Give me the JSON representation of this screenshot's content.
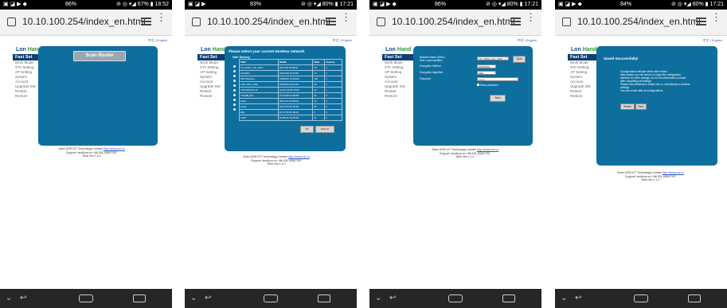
{
  "phones": [
    {
      "status_left": "▣ ◪ ▶ ◆",
      "battery": "86%",
      "status_right": "⊘ ◎ ▾◢ 67% ▮ 18:52",
      "url": "10.10.100.254/index_en.html"
    },
    {
      "status_left": "▣ ◪ ▶",
      "battery": "83%",
      "status_right": "⊘ ◎ ▾◢ 80% ▮ 17:21",
      "url": "10.10.100.254/index_en.html"
    },
    {
      "status_left": "▣ ◪ ▶ ◆",
      "battery": "86%",
      "status_right": "⊘ ◎ ▾◢ 80% ▮ 17:21",
      "url": "10.10.100.254/index_en.html"
    },
    {
      "status_left": "▣ ◪ ▶ ◆",
      "battery": "84%",
      "status_right": "⊘ ◎ ▾◢ 80% ▮ 17:21",
      "url": "10.10.100.254/index_en.html"
    }
  ],
  "lang_links": "中文 | English",
  "brand": {
    "lon": "Lon ",
    "hand": "Hand"
  },
  "nav_items": [
    "Fast Set",
    "Work Mode",
    "STA Setting",
    "AP Setting",
    "System",
    "Account",
    "Upgrade SW",
    "Restart",
    "Restore"
  ],
  "footer": {
    "company": "Jinan USR IOT Technology Limited",
    "link": "http://www.usr.cn",
    "support": "Support: tec@usr.cn +86 531-55507297",
    "version": "Web Ver:1.1.0"
  },
  "screen1": {
    "scan_button": "Scan Router"
  },
  "screen2": {
    "title": "Please select your current wireless network",
    "subtitle": "Site Survey",
    "columns": [
      "SSID",
      "BSSID",
      "RSSI",
      "Channel"
    ],
    "rows": [
      [
        "TP_LINK0_LAN_TEST",
        "28:76:E5:02:8E:54",
        "78",
        "1"
      ],
      [
        "ChinaNet",
        "C8:E6:9D:70:46:68",
        "70",
        "1"
      ],
      [
        "WPS Wireless",
        "C8:B8:8C:FC:E3:E1",
        "100",
        "1"
      ],
      [
        "USR_TEST_WIFI",
        "C8:E8:9C:F2:84:6C",
        "45",
        "1"
      ],
      [
        "USR-WIFI232-42",
        "AC:CF:23:0D:78:D3",
        "54",
        "1"
      ],
      [
        "TOSHB_PIN",
        "7C:F9:6B:72:2B:6B",
        "65",
        "6"
      ],
      [
        "belkin",
        "08:43:3C:1F:DB:2D",
        "42",
        "9"
      ],
      [
        "Guest",
        "E2:A7:00:4C:7E:90",
        "99",
        "6"
      ],
      [
        "jiDE",
        "E7:C7:91:8C:3E:34",
        "6",
        "6"
      ],
      [
        "TEST",
        "F6:6B:4A:7D:F0:95",
        "21",
        "6"
      ]
    ],
    "ok": "OK",
    "refresh": "Refresh"
  },
  "screen3": {
    "network_label": "Network Name (SSID)",
    "network_note": "Note: case sensitive",
    "ssid_value": "TP_LINK0_LAN_TEST",
    "scan_btn": "Scan",
    "enc_method_label": "Encryption Method",
    "enc_method_value": "WPA2PSK",
    "enc_alg_label": "Encryption Algorithm",
    "enc_alg_value": "AES",
    "password_label": "Password",
    "password_value": "••••••••",
    "show_password": "Show password",
    "save_btn": "Save"
  },
  "screen4": {
    "title": "Saved Successfully!",
    "lines": [
      "Configurations will take effect after restart.",
      "After restart, you will need to re-login the configuration",
      "interface for other settings, so it is recommended to restart",
      "after completing all settings.",
      "Please click [Restart] to restart now, or click [Back] to continue",
      "settings.",
      "You can restart after all configurations."
    ],
    "restart_btn": "Restart",
    "back_btn": "Back"
  }
}
